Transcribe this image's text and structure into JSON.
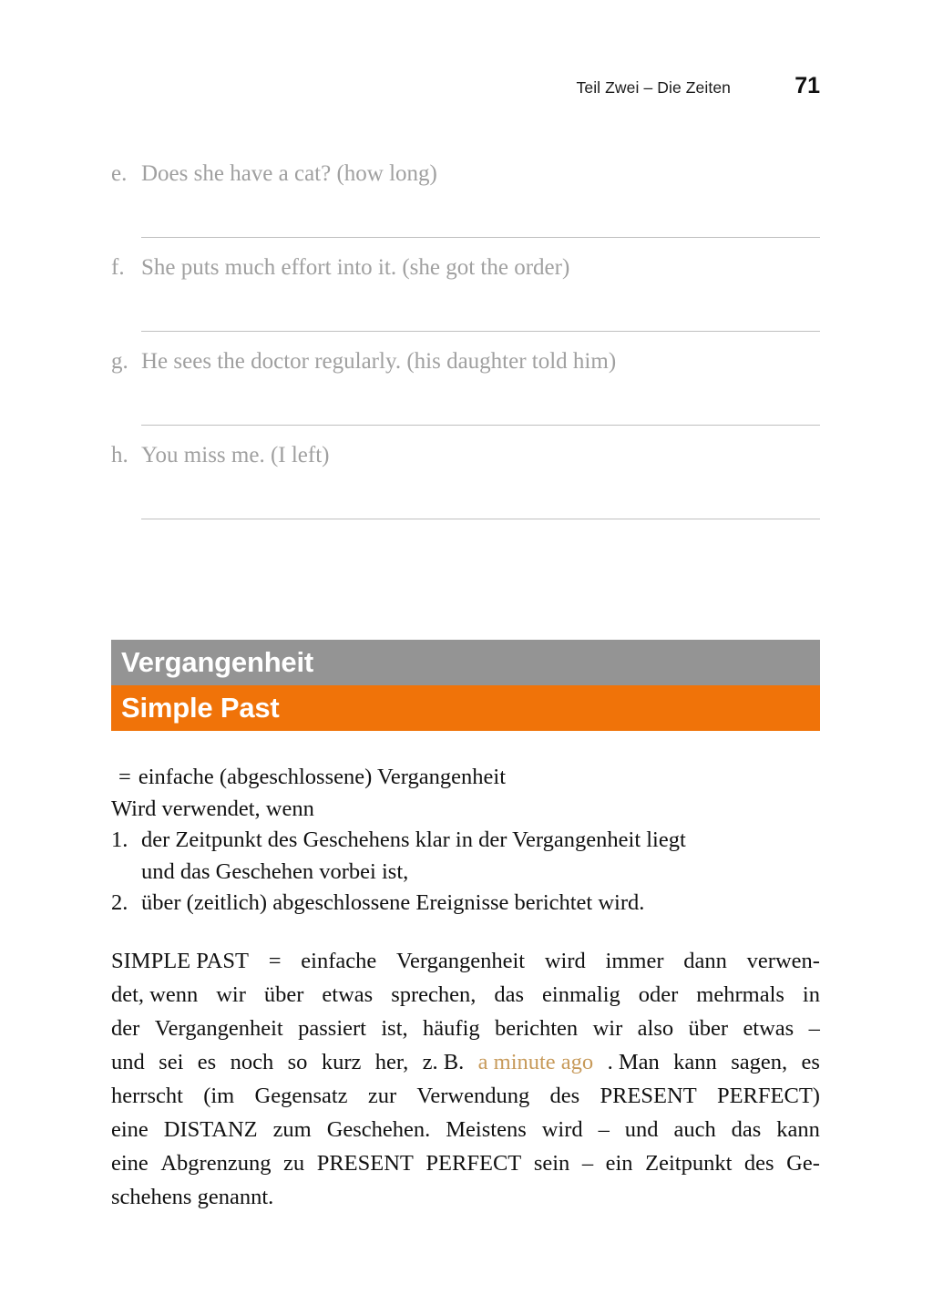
{
  "header": {
    "title": "Teil Zwei – Die Zeiten",
    "page_number": "71"
  },
  "exercises": [
    {
      "marker": "e.",
      "sentence": "Does she have a cat? (how long)"
    },
    {
      "marker": "f.",
      "sentence": "She puts much effort into it. (she got the order)"
    },
    {
      "marker": "g.",
      "sentence": "He sees the doctor regularly. (his daughter told him)"
    },
    {
      "marker": "h.",
      "sentence": "You miss me. (I left)"
    }
  ],
  "section": {
    "banner_de": "Vergangenheit",
    "banner_en": "Simple Past",
    "banner_de_color": "#949494",
    "banner_en_color": "#f07309"
  },
  "definition": {
    "equals_sign": "=",
    "equals_text": "einfache (abgeschlossene) Vergangenheit",
    "intro": "Wird verwendet, wenn",
    "rules": [
      {
        "num": "1.",
        "line1": "der Zeitpunkt des Geschehens klar in der Vergangenheit liegt",
        "line2": "und das Geschehen vorbei ist,"
      },
      {
        "num": "2.",
        "line1": "über (zeitlich) abgeschlossene Ereignisse berichtet wird.",
        "line2": ""
      }
    ]
  },
  "body_paragraph": {
    "highlight_color": "#c79a5a",
    "highlight_text": "a minute ago",
    "full_text": "SIMPLE PAST = einfache Vergangenheit wird immer dann verwendet, wenn wir über etwas sprechen, das einmalig oder mehrmals in der Vergangenheit passiert ist, häufig berichten wir also über etwas – und sei es noch so kurz her, z. B. a minute ago. Man kann sagen, es herrscht (im Gegensatz zur Verwendung des PRESENT PERFECT) eine DISTANZ zum Geschehen. Meistens wird – und auch das kann eine Abgrenzung zu PRESENT PERFECT sein – ein Zeitpunkt des Geschehens genannt.",
    "lines": [
      {
        "a": "SIMPLE PAST",
        "b": "=",
        "c": "einfache",
        "d": "Vergangenheit",
        "e": "wird",
        "f": "immer",
        "g": "dann",
        "h": "verwen-"
      },
      {
        "a": "det, wenn",
        "b": "wir",
        "c": "über",
        "d": "etwas",
        "e": "sprechen,",
        "f": "das",
        "g": "einmalig",
        "h": "oder",
        "i": "mehrmals",
        "j": "in"
      },
      {
        "a": "der",
        "b": "Vergangenheit",
        "c": "passiert",
        "d": "ist,",
        "e": "häufig",
        "f": "berichten",
        "g": "wir",
        "h": "also",
        "i": "über",
        "j": "etwas",
        "k": "–"
      },
      {
        "a": "und",
        "b": "sei",
        "c": "es",
        "d": "noch",
        "e": "so",
        "f": "kurz",
        "g": "her,",
        "h": "z. B.",
        "i": "a minute ago",
        "j": ". Man",
        "k": "kann",
        "l": "sagen,",
        "m": "es"
      },
      {
        "a": "herrscht",
        "b": "(im",
        "c": "Gegensatz",
        "d": "zur",
        "e": "Verwendung",
        "f": "des",
        "g": "PRESENT",
        "h": "PERFECT)"
      },
      {
        "a": "eine",
        "b": "DISTANZ",
        "c": "zum",
        "d": "Geschehen.",
        "e": "Meistens",
        "f": "wird",
        "g": "–",
        "h": "und",
        "i": "auch",
        "j": "das",
        "k": "kann"
      },
      {
        "a": "eine",
        "b": "Abgrenzung",
        "c": "zu",
        "d": "PRESENT",
        "e": "PERFECT",
        "f": "sein",
        "g": "–",
        "h": "ein",
        "i": "Zeitpunkt",
        "j": "des",
        "k": "Ge-"
      },
      {
        "a": "schehens genannt."
      }
    ]
  }
}
